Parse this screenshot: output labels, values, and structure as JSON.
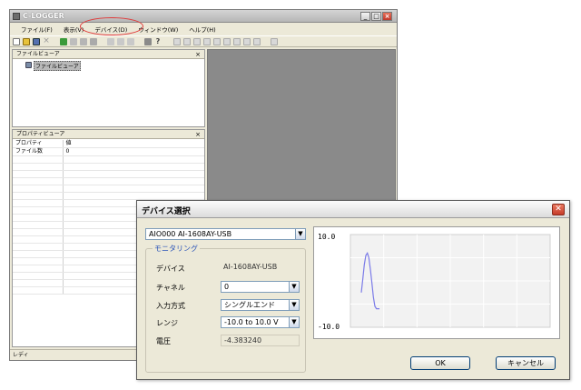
{
  "app": {
    "title": "C-LOGGER"
  },
  "menu": [
    "ファイル(F)",
    "表示(V)",
    "デバイス(D)",
    "ウィンドウ(W)",
    "ヘルプ(H)"
  ],
  "file_viewer": {
    "title": "ファイルビューア",
    "close": "×",
    "item": "ファイルビューア"
  },
  "property_viewer": {
    "title": "プロパティビューア",
    "close": "×",
    "header": {
      "name": "プロパティ",
      "value": "値"
    },
    "rows": [
      {
        "name": "ファイル数",
        "value": "0"
      }
    ]
  },
  "status": "レディ",
  "dialog": {
    "title": "デバイス選択",
    "close": "✕",
    "device": "AIO000 AI-1608AY-USB",
    "monitor_title": "モニタリング",
    "fields": {
      "device_label": "デバイス",
      "device_value": "AI-1608AY-USB",
      "channel_label": "チャネル",
      "channel_value": "0",
      "input_label": "入力方式",
      "input_value": "シングルエンド",
      "range_label": "レンジ",
      "range_value": "-10.0 to 10.0 V",
      "voltage_label": "電圧",
      "voltage_value": "-4.383240"
    },
    "ok": "OK",
    "cancel": "キャンセル"
  },
  "chart_data": {
    "type": "line",
    "ylim": [
      -10.0,
      10.0
    ],
    "yticks": [
      "10.0",
      "-10.0"
    ],
    "grid": true,
    "series": [
      {
        "color": "#7b7be8",
        "x": [
          0,
          1,
          2,
          3,
          4,
          5,
          6,
          7,
          8,
          9,
          10,
          11,
          12
        ],
        "y": [
          -2.5,
          0.5,
          3.5,
          5.5,
          6.0,
          5.0,
          2.5,
          -0.5,
          -3.5,
          -5.5,
          -6.0,
          -6.0,
          -6.0
        ]
      }
    ]
  }
}
